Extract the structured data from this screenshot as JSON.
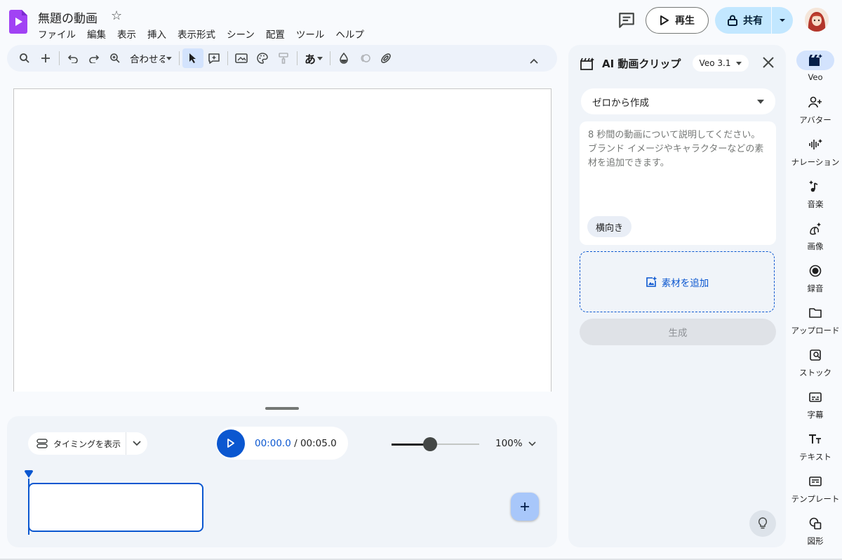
{
  "colors": {
    "accent": "#0b57d0",
    "share_bg": "#c2e7ff",
    "logo": "#a142f4",
    "panel_bg": "#f0f4f9"
  },
  "header": {
    "doc_title": "無題の動画",
    "menu": [
      "ファイル",
      "編集",
      "表示",
      "挿入",
      "表示形式",
      "シーン",
      "配置",
      "ツール",
      "ヘルプ"
    ],
    "play_label": "再生",
    "share_label": "共有"
  },
  "toolbar": {
    "zoom_label": "合わせる",
    "font_label": "あ",
    "icons": [
      "search-icon",
      "add-icon",
      "undo-icon",
      "redo-icon",
      "zoom-icon",
      "select-cursor-icon",
      "add-text-box-icon",
      "background-icon",
      "theme-palette-icon",
      "paint-format-icon",
      "font-icon",
      "fill-color-icon",
      "animation-icon",
      "link-icon"
    ]
  },
  "timeline": {
    "timing_label": "タイミングを表示",
    "current_time": "00:00.0",
    "time_separator": " / ",
    "total_time": "00:05.0",
    "zoom_percent": "100%",
    "zoom_slider_value": 0.44
  },
  "ai_panel": {
    "title": "AI 動画クリップ",
    "model": "Veo 3.1",
    "mode": "ゼロから作成",
    "prompt_placeholder": "8 秒間の動画について説明してください。ブランド イメージやキャラクターなどの素材を追加できます。",
    "orientation": "横向き",
    "add_material_label": "素材を追加",
    "generate_label": "生成"
  },
  "rail": {
    "items": [
      {
        "label": "Veo",
        "icon": "veo-icon",
        "active": true
      },
      {
        "label": "アバター",
        "icon": "avatar-add-icon"
      },
      {
        "label": "ナレーション",
        "icon": "narration-icon"
      },
      {
        "label": "音楽",
        "icon": "music-icon"
      },
      {
        "label": "画像",
        "icon": "image-gen-icon"
      },
      {
        "label": "録音",
        "icon": "record-icon"
      },
      {
        "label": "アップロード",
        "icon": "folder-icon"
      },
      {
        "label": "ストック",
        "icon": "stock-icon"
      },
      {
        "label": "字幕",
        "icon": "captions-icon"
      },
      {
        "label": "テキスト",
        "icon": "text-icon"
      },
      {
        "label": "テンプレート",
        "icon": "template-icon"
      },
      {
        "label": "図形",
        "icon": "shapes-icon"
      }
    ]
  }
}
